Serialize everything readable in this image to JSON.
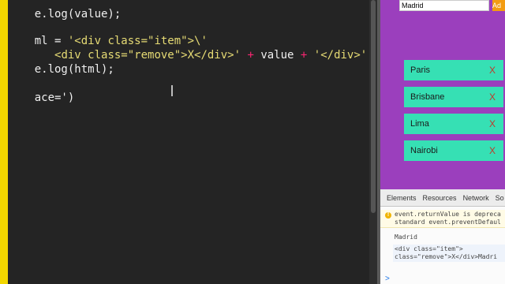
{
  "editor": {
    "lines": [
      {
        "plain_a": "e.log(value);"
      },
      {
        "plain_a": "ml = ",
        "str_a": "'<div class=\"item\">\\'"
      },
      {
        "plain_a": "   ",
        "str_a": "<div class=\"remove\">X</div>'",
        "op_a": " + ",
        "plain_b": "value",
        "op_b": " + ",
        "str_b": "'</div>';"
      },
      {
        "plain_a": "e.log(html);"
      },
      {
        "plain_a": "ace=')"
      }
    ]
  },
  "preview": {
    "input_value": "Madrid",
    "add_button_label": "Ad",
    "items": [
      {
        "label": "Paris",
        "remove": "X"
      },
      {
        "label": "Brisbane",
        "remove": "X"
      },
      {
        "label": "Lima",
        "remove": "X"
      },
      {
        "label": "Nairobi",
        "remove": "X"
      }
    ]
  },
  "devtools": {
    "tabs": [
      "Elements",
      "Resources",
      "Network",
      "So"
    ],
    "warning_line1": "event.returnValue is depreca",
    "warning_line2": "standard event.preventDefaul",
    "log_value": "Madrid",
    "html_line1": "<div class=\"item\">",
    "html_line2": "class=\"remove\">X</div>Madri",
    "prompt": ">"
  },
  "colors": {
    "gutter": "#f2d600",
    "preview_bg": "#9b3fbd",
    "item_bg": "#36e0b4",
    "remove_x": "#c0392b",
    "add_button": "#f39c12"
  }
}
